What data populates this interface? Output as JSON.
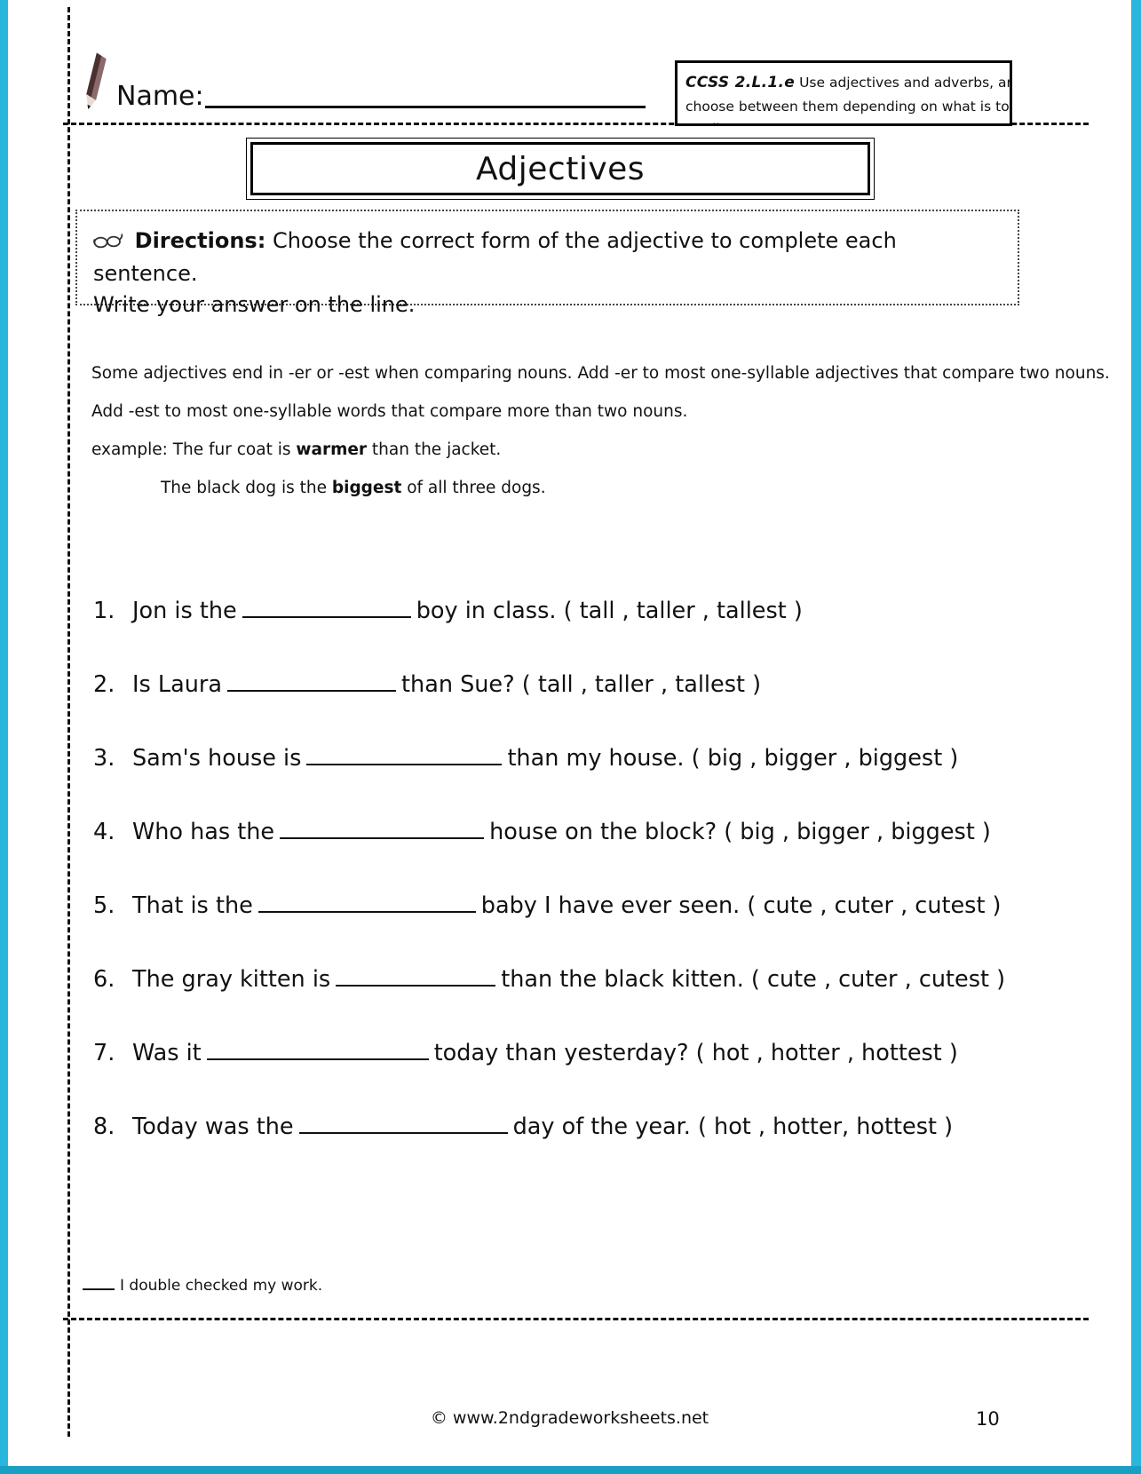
{
  "header": {
    "pencil_icon": "pencil-icon",
    "name_label": "Name:",
    "ccss": {
      "code": "CCSS 2.L.1.e",
      "description": "Use adjectives and adverbs, and choose between them depending on what is to be modi-"
    }
  },
  "title": "Adjectives",
  "directions": {
    "glasses_icon": "glasses-icon",
    "label": "Directions:",
    "line1": "Choose the correct form of the adjective to complete each sentence.",
    "line2": "Write your answer on the line."
  },
  "rules": [
    "Some adjectives end in -er or -est when comparing nouns.  Add -er to most one-syllable adjectives that compare two nouns.",
    "Add -est to most one-syllable words that compare more than two nouns."
  ],
  "examples": [
    {
      "prefix": "example: The fur coat is ",
      "bold": "warmer",
      "suffix": " than the jacket.",
      "indent": false
    },
    {
      "prefix": "The black dog is the ",
      "bold": "biggest",
      "suffix": " of all three dogs.",
      "indent": true
    }
  ],
  "questions": [
    {
      "num": "1.",
      "before": "Jon is the",
      "blank_width": 190,
      "after": "boy in class. ( tall , taller , tallest )"
    },
    {
      "num": "2.",
      "before": "Is Laura",
      "blank_width": 190,
      "after": "than Sue? ( tall , taller , tallest )"
    },
    {
      "num": "3.",
      "before": "Sam's house is",
      "blank_width": 220,
      "after": "than my house. ( big , bigger , biggest )"
    },
    {
      "num": "4.",
      "before": " Who has the",
      "blank_width": 230,
      "after": "house on the block? ( big , bigger , biggest )"
    },
    {
      "num": "5.",
      "before": "That is the",
      "blank_width": 245,
      "after": "baby I have ever seen. ( cute , cuter , cutest )"
    },
    {
      "num": "6.",
      "before": "The gray kitten is",
      "blank_width": 180,
      "after": "than the black kitten. ( cute , cuter , cutest )"
    },
    {
      "num": "7.",
      "before": " Was it",
      "blank_width": 250,
      "after": "today than yesterday? ( hot , hotter , hottest )"
    },
    {
      "num": "8.",
      "before": "Today was the",
      "blank_width": 235,
      "after": "day of the year. ( hot , hotter, hottest )"
    }
  ],
  "double_check": "I double checked my work.",
  "footer": {
    "copyright": "© www.2ndgradeworksheets.net",
    "page_number": "10"
  },
  "colors": {
    "page_edge": "#29b6dd",
    "ink": "#111111",
    "pencil_body": "#5a3a3a"
  }
}
